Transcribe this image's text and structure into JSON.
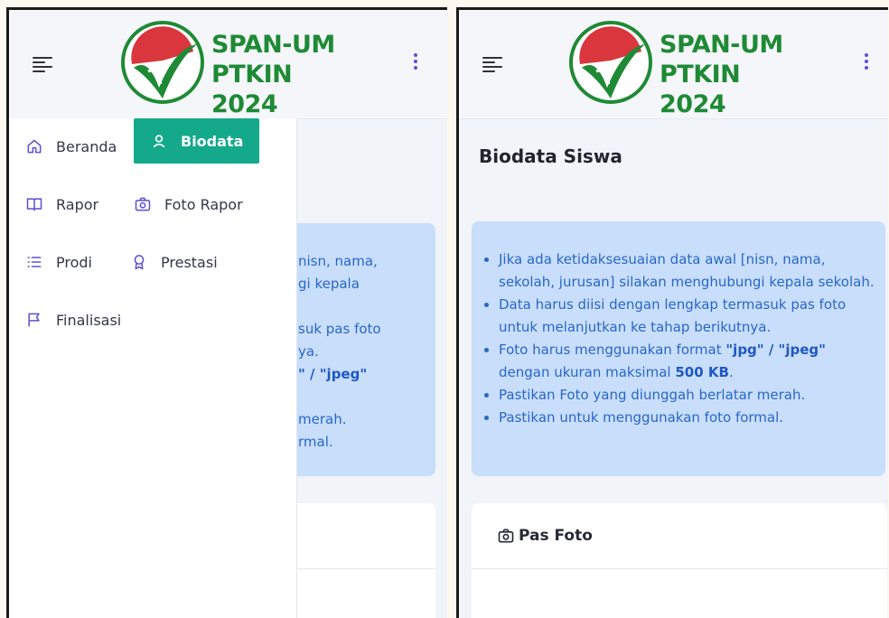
{
  "logo": {
    "line1": "SPAN-UM",
    "line2": "PTKIN 2024"
  },
  "nav": {
    "items": [
      {
        "label": "Beranda",
        "icon": "home-icon"
      },
      {
        "label": "Biodata",
        "icon": "user-icon"
      },
      {
        "label": "Rapor",
        "icon": "book-icon"
      },
      {
        "label": "Foto Rapor",
        "icon": "camera-icon"
      },
      {
        "label": "Prodi",
        "icon": "list-icon"
      },
      {
        "label": "Prestasi",
        "icon": "award-icon"
      },
      {
        "label": "Finalisasi",
        "icon": "flag-icon"
      }
    ],
    "active": "Biodata"
  },
  "page": {
    "title": "Biodata Siswa"
  },
  "notice": {
    "items": [
      {
        "text": "Jika ada ketidaksesuaian data awal [nisn, nama, sekolah, jurusan] silakan menghubungi kepala sekolah."
      },
      {
        "text": "Data harus diisi dengan lengkap termasuk pas foto untuk melanjutkan ke tahap berikutnya."
      },
      {
        "pre": "Foto harus menggunakan format ",
        "bold1": "\"jpg\" / \"jpeg\"",
        "mid": " dengan ukuran maksimal ",
        "bold2": "500 KB",
        "post": "."
      },
      {
        "text": "Pastikan Foto yang diunggah berlatar merah."
      },
      {
        "text": "Pastikan untuk menggunakan foto formal."
      }
    ],
    "partial_left": [
      "nisn, nama,",
      "gi kepala",
      "",
      "suk pas foto",
      "ya.",
      "\" / \"jpeg\"",
      "",
      "merah.",
      "rmal."
    ]
  },
  "photo_card": {
    "title": "Pas Foto"
  },
  "colors": {
    "accent": "#14a98b",
    "notice_bg": "#c8defb",
    "notice_text": "#2a66c9",
    "nav_icon": "#5b50d6",
    "logo_green": "#1f8a35"
  }
}
